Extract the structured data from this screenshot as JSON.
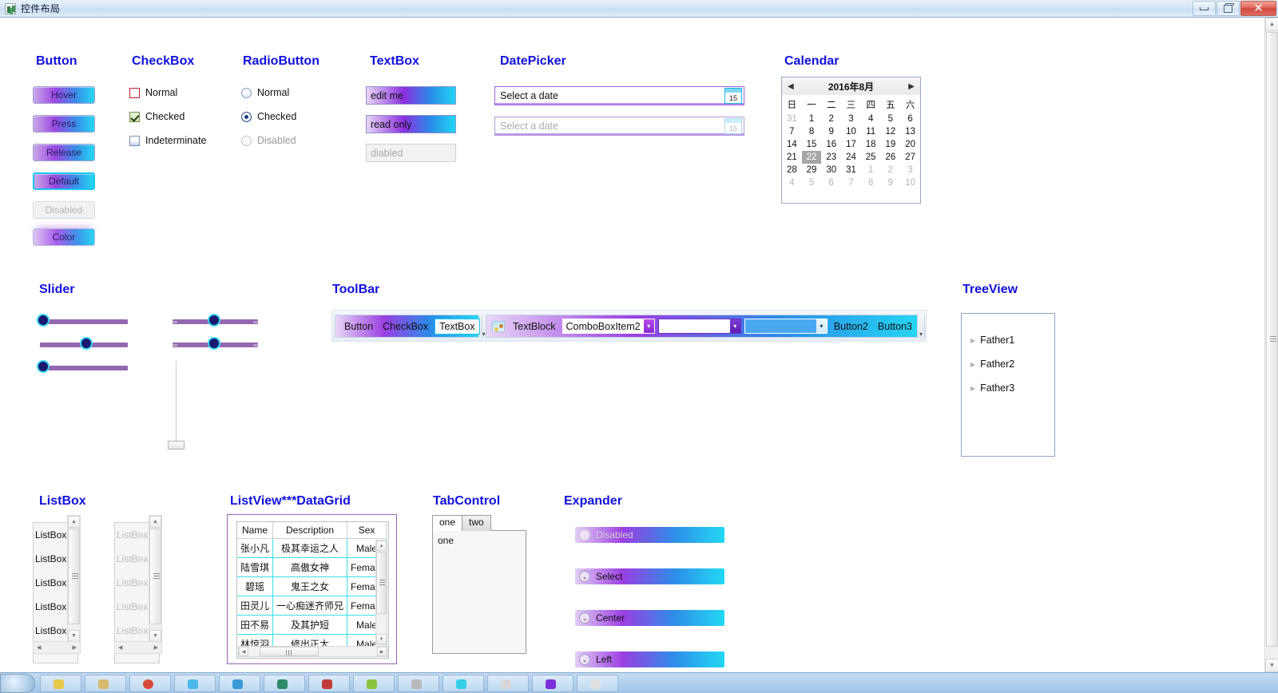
{
  "window": {
    "title": "控件布局",
    "icon": "app-icon",
    "minimize_label": "Minimize",
    "maximize_label": "Maximize",
    "close_label": "✕"
  },
  "sections": {
    "button": "Button",
    "checkbox": "CheckBox",
    "radiobutton": "RadioButton",
    "textbox": "TextBox",
    "datepicker": "DatePicker",
    "calendar": "Calendar",
    "slider": "Slider",
    "toolbar": "ToolBar",
    "treeview": "TreeView",
    "listbox": "ListBox",
    "listview": "ListView***DataGrid",
    "tabcontrol": "TabControl",
    "expander": "Expander"
  },
  "buttons": [
    {
      "label": "Hover",
      "state": "hover"
    },
    {
      "label": "Press",
      "state": "press"
    },
    {
      "label": "Release",
      "state": "release"
    },
    {
      "label": "Default",
      "state": "default"
    },
    {
      "label": "Disabled",
      "state": "disabled"
    },
    {
      "label": "Color",
      "state": "color"
    }
  ],
  "checkboxes": [
    {
      "label": "Normal",
      "state": "unchecked"
    },
    {
      "label": "Checked",
      "state": "checked"
    },
    {
      "label": "Indeterminate",
      "state": "indeterminate"
    }
  ],
  "radiobuttons": [
    {
      "label": "Normal",
      "state": "off"
    },
    {
      "label": "Checked",
      "state": "on"
    },
    {
      "label": "Disabled",
      "state": "disabled"
    }
  ],
  "textboxes": [
    {
      "value": "edit me",
      "state": "editable"
    },
    {
      "value": "read only",
      "state": "readonly"
    },
    {
      "value": "diabled",
      "state": "disabled"
    }
  ],
  "datepickers": [
    {
      "value": "Select a date",
      "state": "enabled",
      "button_day": "15"
    },
    {
      "value": "Select a date",
      "state": "disabled",
      "button_day": "15"
    }
  ],
  "calendar": {
    "header": "2016年8月",
    "prev": "◀",
    "next": "▶",
    "daynames": [
      "日",
      "一",
      "二",
      "三",
      "四",
      "五",
      "六"
    ],
    "weeks": [
      [
        {
          "d": "31",
          "t": "out"
        },
        {
          "d": "1"
        },
        {
          "d": "2"
        },
        {
          "d": "3"
        },
        {
          "d": "4"
        },
        {
          "d": "5"
        },
        {
          "d": "6"
        }
      ],
      [
        {
          "d": "7"
        },
        {
          "d": "8"
        },
        {
          "d": "9"
        },
        {
          "d": "10"
        },
        {
          "d": "11"
        },
        {
          "d": "12"
        },
        {
          "d": "13"
        }
      ],
      [
        {
          "d": "14"
        },
        {
          "d": "15"
        },
        {
          "d": "16"
        },
        {
          "d": "17"
        },
        {
          "d": "18"
        },
        {
          "d": "19"
        },
        {
          "d": "20"
        }
      ],
      [
        {
          "d": "21"
        },
        {
          "d": "22",
          "t": "sel"
        },
        {
          "d": "23"
        },
        {
          "d": "24"
        },
        {
          "d": "25"
        },
        {
          "d": "26"
        },
        {
          "d": "27"
        }
      ],
      [
        {
          "d": "28"
        },
        {
          "d": "29"
        },
        {
          "d": "30"
        },
        {
          "d": "31"
        },
        {
          "d": "1",
          "t": "out"
        },
        {
          "d": "2",
          "t": "out"
        },
        {
          "d": "3",
          "t": "out"
        }
      ],
      [
        {
          "d": "4",
          "t": "out"
        },
        {
          "d": "5",
          "t": "out"
        },
        {
          "d": "6",
          "t": "out"
        },
        {
          "d": "7",
          "t": "out"
        },
        {
          "d": "8",
          "t": "out"
        },
        {
          "d": "9",
          "t": "out"
        },
        {
          "d": "10",
          "t": "out"
        }
      ]
    ],
    "selected_day": "22"
  },
  "sliders": {
    "horizontal": [
      {
        "name": "slider-left-top",
        "value_pct": 0
      },
      {
        "name": "slider-left-middle",
        "value_pct": 50
      },
      {
        "name": "slider-left-bottom",
        "value_pct": 0
      },
      {
        "name": "slider-right-top",
        "value_pct": 48
      },
      {
        "name": "slider-right-middle",
        "value_pct": 48
      }
    ],
    "vertical": [
      {
        "name": "slider-vertical",
        "value_pct": 0
      }
    ]
  },
  "toolbar": {
    "group1": {
      "items": [
        "Button",
        "CheckBox"
      ],
      "textbox_value": "TextBox",
      "overflow": "▾"
    },
    "group2": {
      "image_icon": "picture-icon",
      "textblock": "TextBlock",
      "combo1_value": "ComboBoxItem2",
      "combo2_value": "",
      "combo3_value": "",
      "buttons": [
        "Button2",
        "Button3"
      ],
      "overflow": "▾"
    }
  },
  "treeview": {
    "items": [
      {
        "label": "Father1",
        "expander": "▶"
      },
      {
        "label": "Father2",
        "expander": "▶"
      },
      {
        "label": "Father3",
        "expander": "▶"
      }
    ]
  },
  "listboxes": [
    {
      "name": "listbox-enabled",
      "items": [
        "ListBoxItem",
        "ListBoxItem",
        "ListBoxItem",
        "ListBoxItem",
        "ListBoxItem"
      ],
      "state": "enabled"
    },
    {
      "name": "listbox-disabled",
      "items": [
        "ListBoxItem",
        "ListBoxItem",
        "ListBoxItem",
        "ListBoxItem",
        "ListBoxItem"
      ],
      "state": "disabled"
    }
  ],
  "datagrid": {
    "columns": [
      "Name",
      "Description",
      "Sex"
    ],
    "rows": [
      [
        "张小凡",
        "极其幸运之人",
        "Male"
      ],
      [
        "陆雪琪",
        "高傲女神",
        "Female"
      ],
      [
        "碧瑶",
        "鬼王之女",
        "Female"
      ],
      [
        "田灵儿",
        "一心痴迷齐师兄",
        "Female"
      ],
      [
        "田不易",
        "及其护短",
        "Male"
      ],
      [
        "林惊羽",
        "修出正太",
        "Male"
      ]
    ]
  },
  "tabcontrol": {
    "tabs": [
      {
        "label": "one",
        "active": true
      },
      {
        "label": "two",
        "active": false
      }
    ],
    "content": "one"
  },
  "expanders": [
    {
      "label": "Disabled",
      "state": "disabled",
      "arrow": "⌄"
    },
    {
      "label": "Select",
      "state": "enabled",
      "arrow": "⌄"
    },
    {
      "label": "Center",
      "state": "enabled",
      "arrow": "⌄"
    },
    {
      "label": "Left",
      "state": "enabled",
      "arrow": "⌄"
    }
  ],
  "scrollbars": {
    "page_up": "▲",
    "page_down": "▼",
    "left": "◀",
    "right": "▶"
  },
  "colors": {
    "heading": "#1111dd",
    "gradient_start": "#d9b9ef",
    "gradient_mid": "#8b2fe0",
    "gradient_end": "#22d9f5",
    "slider_track": "#9467b0",
    "slider_thumb": "#191970",
    "slider_thumb_ring": "#36d7f0",
    "datagrid_cell_border": "#37e0ea",
    "calendar_selected": "#a6a6a6"
  }
}
